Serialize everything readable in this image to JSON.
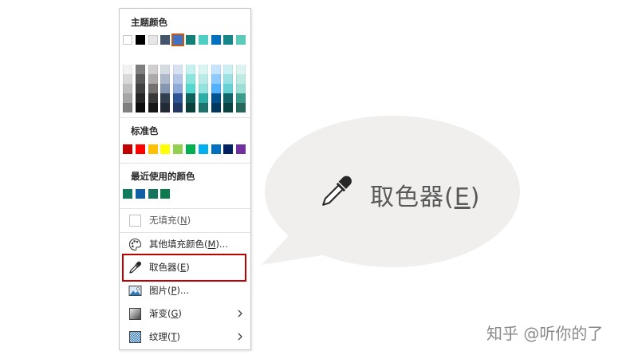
{
  "menu": {
    "theme_colors_title": "主题颜色",
    "standard_colors_title": "标准色",
    "recent_colors_title": "最近使用的颜色",
    "theme_colors": [
      "#FFFFFF",
      "#000000",
      "#E7E6E6",
      "#44546A",
      "#4472C4",
      "#128079",
      "#4ECFC6",
      "#0070C0",
      "#17868A",
      "#5BCAB8"
    ],
    "selected_theme_index": 4,
    "tint_columns": [
      [
        "#F2F2F2",
        "#D9D9D9",
        "#BFBFBF",
        "#A6A6A6",
        "#808080"
      ],
      [
        "#7F7F7F",
        "#595959",
        "#404040",
        "#262626",
        "#0D0D0D"
      ],
      [
        "#D0CECE",
        "#AEAAAA",
        "#767171",
        "#3B3838",
        "#181717"
      ],
      [
        "#D6DCE4",
        "#ADB9CA",
        "#8496B0",
        "#323F4F",
        "#222A35"
      ],
      [
        "#D9E2F3",
        "#B4C6E7",
        "#8EAADB",
        "#2F5496",
        "#1F3864"
      ],
      [
        "#C5F2EF",
        "#8BE5DF",
        "#52D8CF",
        "#0E605A",
        "#09403C"
      ],
      [
        "#DBF5F4",
        "#B8EBE8",
        "#94E2DD",
        "#2BAFA6",
        "#1D746E"
      ],
      [
        "#C5E5FF",
        "#8BCBFF",
        "#50B1FF",
        "#00538F",
        "#003860"
      ],
      [
        "#CCF0F1",
        "#99E1E3",
        "#66D2D5",
        "#116467",
        "#0B4345"
      ],
      [
        "#DEF4F1",
        "#BDEAE3",
        "#9DDFD4",
        "#3B9C8C",
        "#27685D"
      ]
    ],
    "standard_colors": [
      "#C00000",
      "#FF0000",
      "#FFC000",
      "#FFFF00",
      "#92D050",
      "#00B050",
      "#00B0F0",
      "#0070C0",
      "#002060",
      "#7030A0"
    ],
    "recent_colors": [
      "#0F7B5E",
      "#0F5FA8",
      "#16755F",
      "#0D7A50"
    ],
    "items": [
      {
        "name": "no-fill",
        "text": "无填充(",
        "key": "N",
        "end": ")",
        "icon": "empty-box-icon",
        "disabled": true
      },
      {
        "name": "more-fill-colors",
        "text": "其他填充颜色(",
        "key": "M",
        "end": ")...",
        "icon": "palette-icon"
      },
      {
        "name": "eyedropper",
        "text": "取色器(",
        "key": "E",
        "end": ")",
        "icon": "eyedropper-icon"
      },
      {
        "name": "picture",
        "text": "图片(",
        "key": "P",
        "end": ")...",
        "icon": "picture-icon"
      },
      {
        "name": "gradient",
        "text": "渐变(",
        "key": "G",
        "end": ")",
        "icon": "gradient-icon",
        "submenu": true
      },
      {
        "name": "texture",
        "text": "纹理(",
        "key": "T",
        "end": ")",
        "icon": "texture-icon",
        "submenu": true
      }
    ]
  },
  "callout": {
    "text": "取色器(",
    "key": "E",
    "end": ")",
    "icon": "eyedropper-icon",
    "bg": "#F0EFED"
  },
  "watermark": "知乎 @听你的了",
  "colors": {
    "highlight": "#C00000",
    "accent": "#C55A11"
  }
}
